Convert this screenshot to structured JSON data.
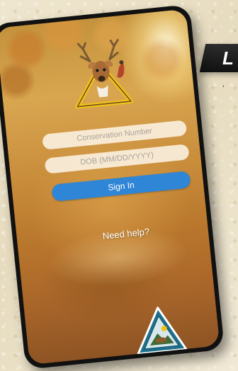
{
  "banner": {
    "text": "L",
    "sub": "'"
  },
  "login": {
    "conservation_placeholder": "Conservation Number",
    "dob_placeholder": "DOB (MM/DD/YYYY)",
    "signin_label": "Sign In",
    "help_label": "Need help?"
  },
  "colors": {
    "button": "#2f86d6",
    "phone_frame": "#111111",
    "background": "#ece3cc"
  },
  "icons": {
    "top_logo": "deer-triangle-emblem-icon",
    "bottom_logo": "conservation-triangle-seal-icon"
  }
}
